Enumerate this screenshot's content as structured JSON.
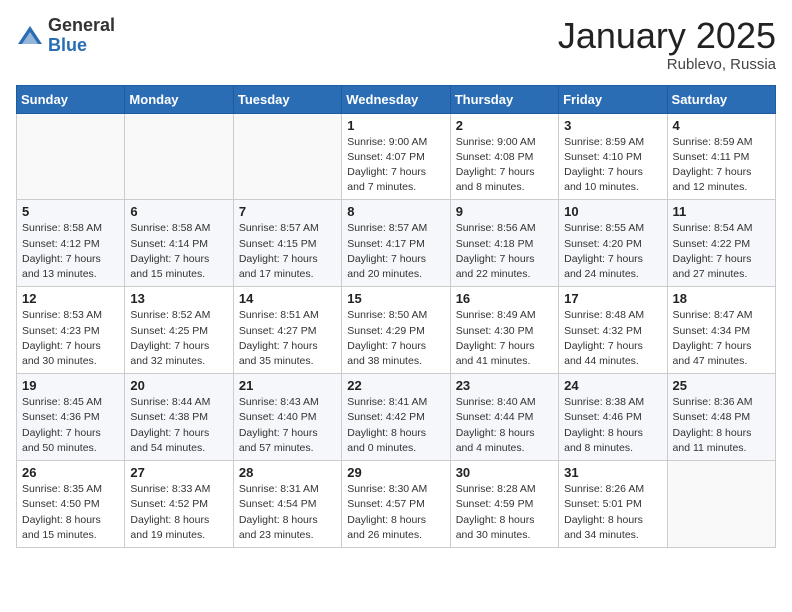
{
  "logo": {
    "general": "General",
    "blue": "Blue"
  },
  "header": {
    "month": "January 2025",
    "location": "Rublevo, Russia"
  },
  "weekdays": [
    "Sunday",
    "Monday",
    "Tuesday",
    "Wednesday",
    "Thursday",
    "Friday",
    "Saturday"
  ],
  "weeks": [
    [
      {
        "day": "",
        "info": ""
      },
      {
        "day": "",
        "info": ""
      },
      {
        "day": "",
        "info": ""
      },
      {
        "day": "1",
        "info": "Sunrise: 9:00 AM\nSunset: 4:07 PM\nDaylight: 7 hours\nand 7 minutes."
      },
      {
        "day": "2",
        "info": "Sunrise: 9:00 AM\nSunset: 4:08 PM\nDaylight: 7 hours\nand 8 minutes."
      },
      {
        "day": "3",
        "info": "Sunrise: 8:59 AM\nSunset: 4:10 PM\nDaylight: 7 hours\nand 10 minutes."
      },
      {
        "day": "4",
        "info": "Sunrise: 8:59 AM\nSunset: 4:11 PM\nDaylight: 7 hours\nand 12 minutes."
      }
    ],
    [
      {
        "day": "5",
        "info": "Sunrise: 8:58 AM\nSunset: 4:12 PM\nDaylight: 7 hours\nand 13 minutes."
      },
      {
        "day": "6",
        "info": "Sunrise: 8:58 AM\nSunset: 4:14 PM\nDaylight: 7 hours\nand 15 minutes."
      },
      {
        "day": "7",
        "info": "Sunrise: 8:57 AM\nSunset: 4:15 PM\nDaylight: 7 hours\nand 17 minutes."
      },
      {
        "day": "8",
        "info": "Sunrise: 8:57 AM\nSunset: 4:17 PM\nDaylight: 7 hours\nand 20 minutes."
      },
      {
        "day": "9",
        "info": "Sunrise: 8:56 AM\nSunset: 4:18 PM\nDaylight: 7 hours\nand 22 minutes."
      },
      {
        "day": "10",
        "info": "Sunrise: 8:55 AM\nSunset: 4:20 PM\nDaylight: 7 hours\nand 24 minutes."
      },
      {
        "day": "11",
        "info": "Sunrise: 8:54 AM\nSunset: 4:22 PM\nDaylight: 7 hours\nand 27 minutes."
      }
    ],
    [
      {
        "day": "12",
        "info": "Sunrise: 8:53 AM\nSunset: 4:23 PM\nDaylight: 7 hours\nand 30 minutes."
      },
      {
        "day": "13",
        "info": "Sunrise: 8:52 AM\nSunset: 4:25 PM\nDaylight: 7 hours\nand 32 minutes."
      },
      {
        "day": "14",
        "info": "Sunrise: 8:51 AM\nSunset: 4:27 PM\nDaylight: 7 hours\nand 35 minutes."
      },
      {
        "day": "15",
        "info": "Sunrise: 8:50 AM\nSunset: 4:29 PM\nDaylight: 7 hours\nand 38 minutes."
      },
      {
        "day": "16",
        "info": "Sunrise: 8:49 AM\nSunset: 4:30 PM\nDaylight: 7 hours\nand 41 minutes."
      },
      {
        "day": "17",
        "info": "Sunrise: 8:48 AM\nSunset: 4:32 PM\nDaylight: 7 hours\nand 44 minutes."
      },
      {
        "day": "18",
        "info": "Sunrise: 8:47 AM\nSunset: 4:34 PM\nDaylight: 7 hours\nand 47 minutes."
      }
    ],
    [
      {
        "day": "19",
        "info": "Sunrise: 8:45 AM\nSunset: 4:36 PM\nDaylight: 7 hours\nand 50 minutes."
      },
      {
        "day": "20",
        "info": "Sunrise: 8:44 AM\nSunset: 4:38 PM\nDaylight: 7 hours\nand 54 minutes."
      },
      {
        "day": "21",
        "info": "Sunrise: 8:43 AM\nSunset: 4:40 PM\nDaylight: 7 hours\nand 57 minutes."
      },
      {
        "day": "22",
        "info": "Sunrise: 8:41 AM\nSunset: 4:42 PM\nDaylight: 8 hours\nand 0 minutes."
      },
      {
        "day": "23",
        "info": "Sunrise: 8:40 AM\nSunset: 4:44 PM\nDaylight: 8 hours\nand 4 minutes."
      },
      {
        "day": "24",
        "info": "Sunrise: 8:38 AM\nSunset: 4:46 PM\nDaylight: 8 hours\nand 8 minutes."
      },
      {
        "day": "25",
        "info": "Sunrise: 8:36 AM\nSunset: 4:48 PM\nDaylight: 8 hours\nand 11 minutes."
      }
    ],
    [
      {
        "day": "26",
        "info": "Sunrise: 8:35 AM\nSunset: 4:50 PM\nDaylight: 8 hours\nand 15 minutes."
      },
      {
        "day": "27",
        "info": "Sunrise: 8:33 AM\nSunset: 4:52 PM\nDaylight: 8 hours\nand 19 minutes."
      },
      {
        "day": "28",
        "info": "Sunrise: 8:31 AM\nSunset: 4:54 PM\nDaylight: 8 hours\nand 23 minutes."
      },
      {
        "day": "29",
        "info": "Sunrise: 8:30 AM\nSunset: 4:57 PM\nDaylight: 8 hours\nand 26 minutes."
      },
      {
        "day": "30",
        "info": "Sunrise: 8:28 AM\nSunset: 4:59 PM\nDaylight: 8 hours\nand 30 minutes."
      },
      {
        "day": "31",
        "info": "Sunrise: 8:26 AM\nSunset: 5:01 PM\nDaylight: 8 hours\nand 34 minutes."
      },
      {
        "day": "",
        "info": ""
      }
    ]
  ]
}
